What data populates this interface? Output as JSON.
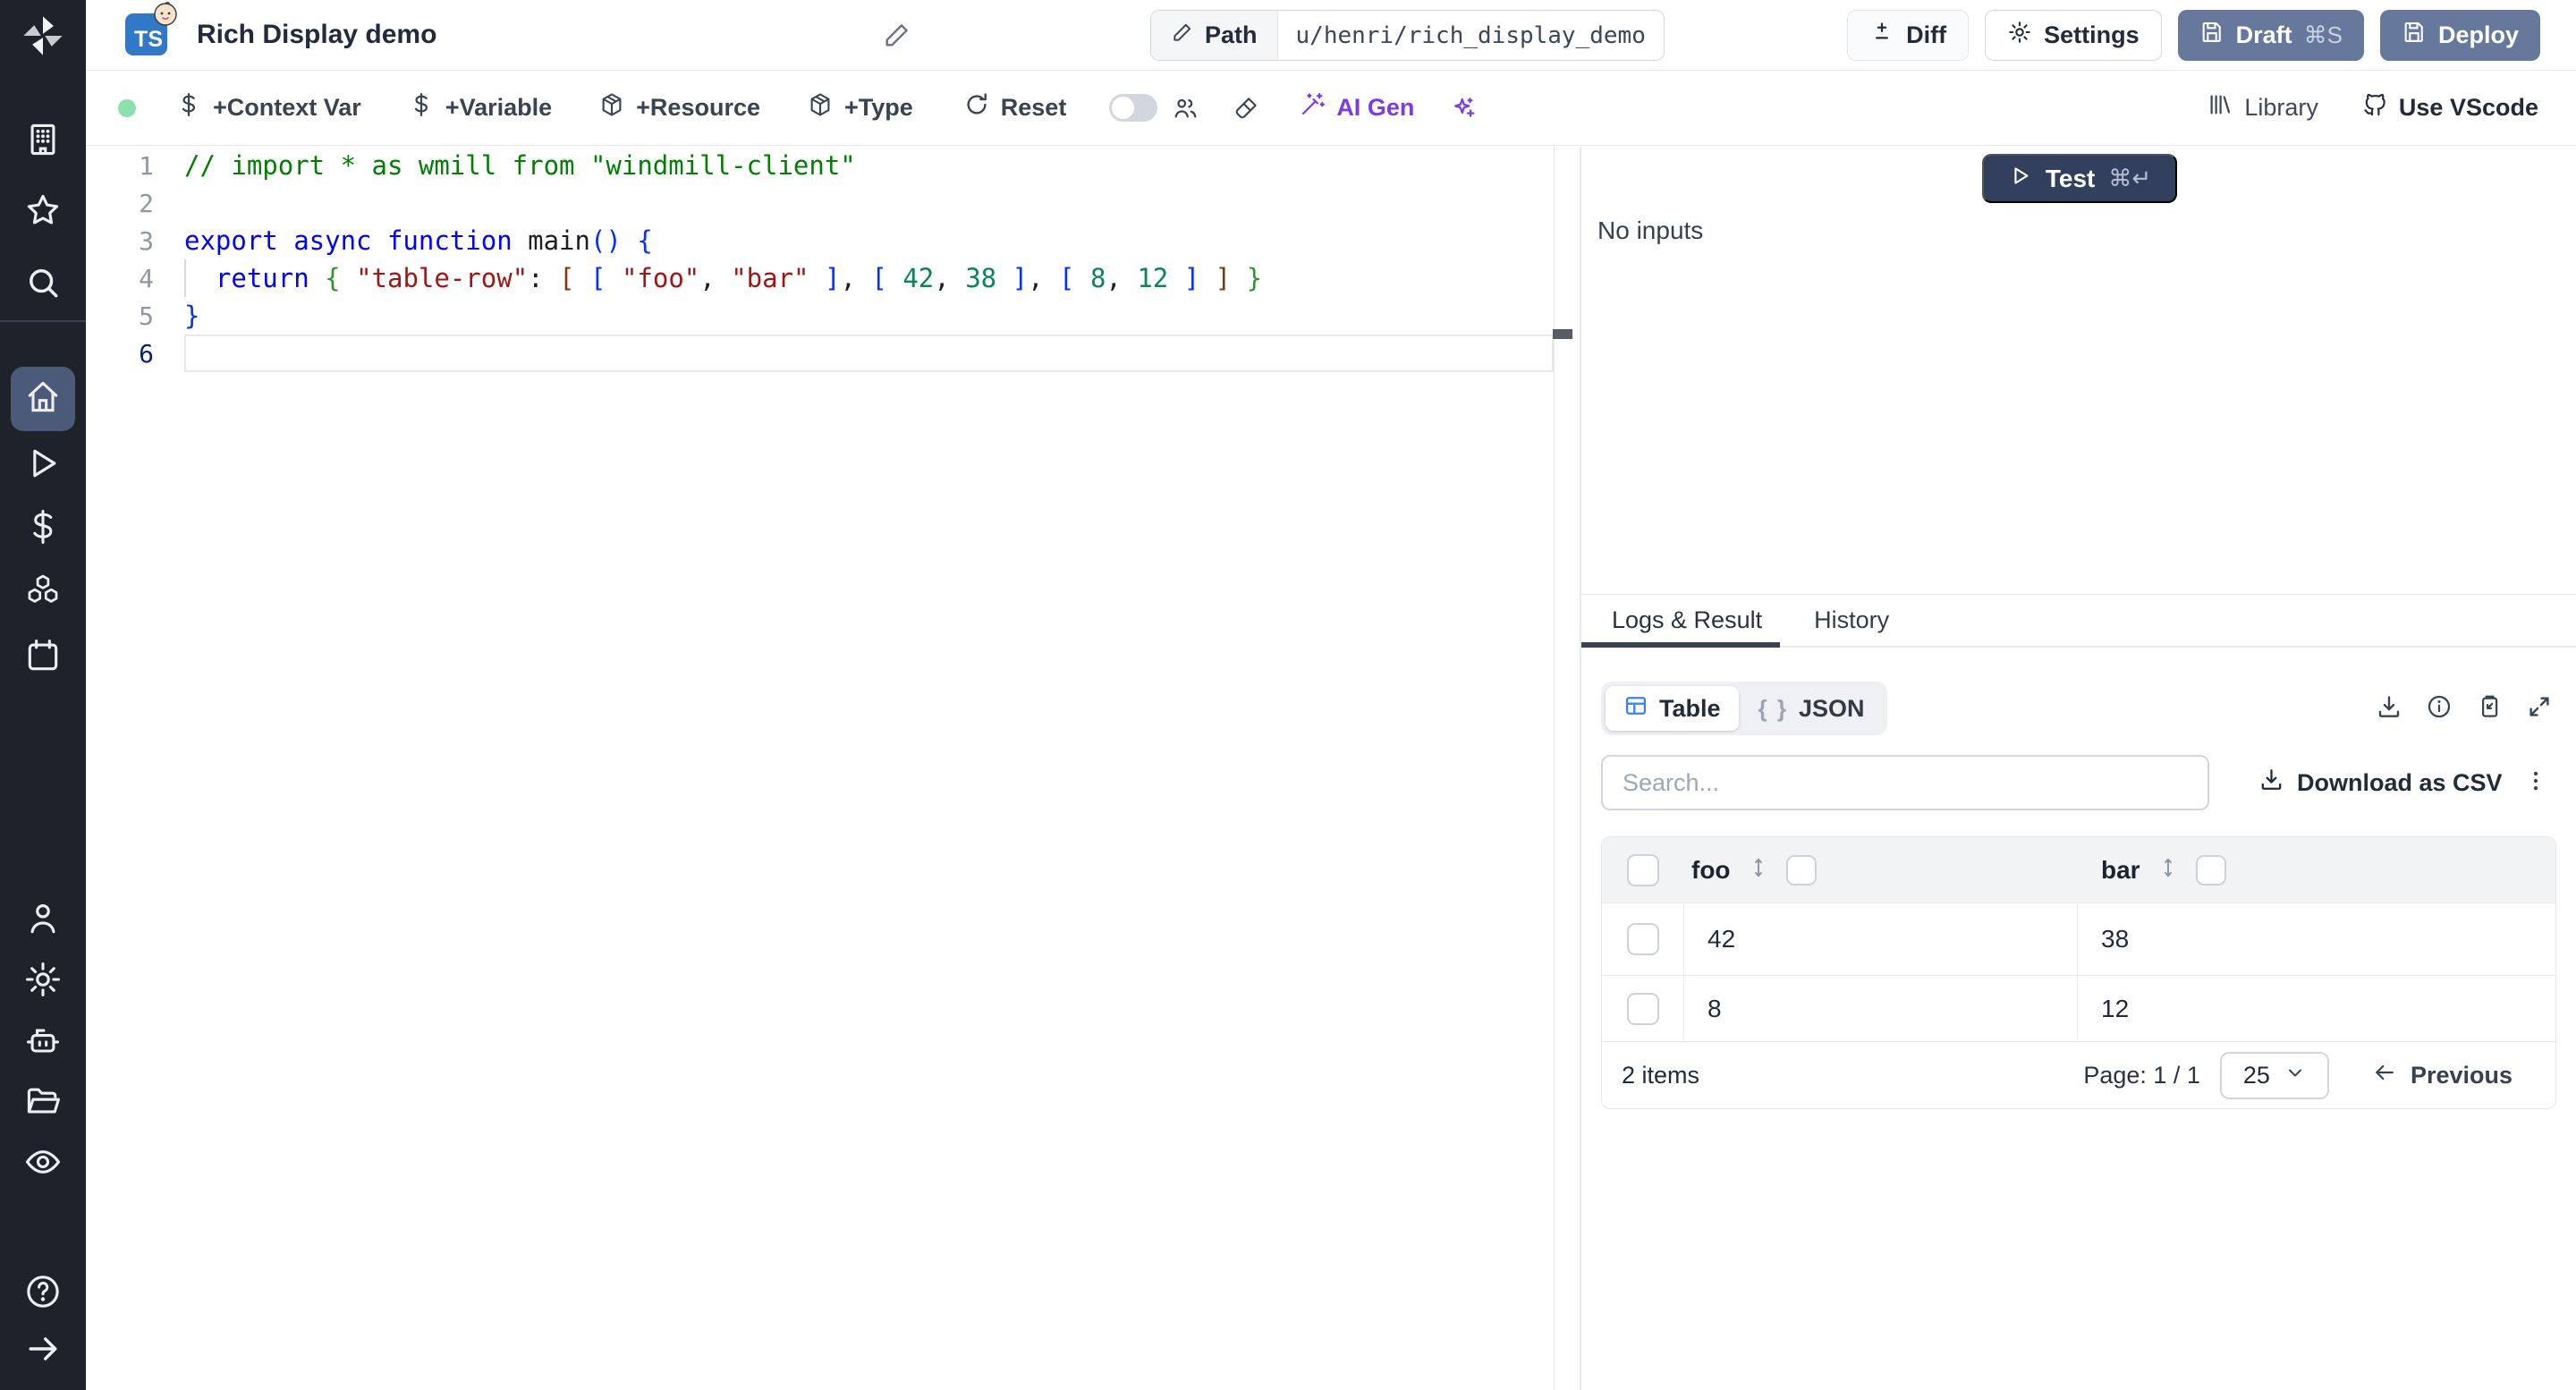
{
  "header": {
    "title": "Rich Display demo",
    "language_badge": "TS",
    "path_label": "Path",
    "path_value": "u/henri/rich_display_demo",
    "diff_label": "Diff",
    "settings_label": "Settings",
    "draft_label": "Draft",
    "draft_shortcut": "⌘S",
    "deploy_label": "Deploy"
  },
  "toolbar": {
    "add_context_var": "+Context Var",
    "add_variable": "+Variable",
    "add_resource": "+Resource",
    "add_type": "+Type",
    "reset": "Reset",
    "ai_gen": "AI Gen",
    "library": "Library",
    "use_vscode": "Use VScode"
  },
  "editor": {
    "lines": [
      {
        "n": "1",
        "tokens": [
          [
            "// import * as wmill from \"windmill-client\"",
            "comment"
          ]
        ]
      },
      {
        "n": "2",
        "tokens": []
      },
      {
        "n": "3",
        "tokens": [
          [
            "export async function ",
            "kw"
          ],
          [
            "main",
            "fn"
          ],
          [
            "(",
            "b1"
          ],
          [
            ")",
            "b1"
          ],
          [
            " ",
            "pn"
          ],
          [
            "{",
            "b1"
          ]
        ]
      },
      {
        "n": "4",
        "tokens": [
          [
            "  ",
            "pn"
          ],
          [
            "return",
            "kw"
          ],
          [
            " ",
            "pn"
          ],
          [
            "{",
            "b2"
          ],
          [
            " ",
            "pn"
          ],
          [
            "\"table-row\"",
            "str"
          ],
          [
            ":",
            "pn"
          ],
          [
            " ",
            "pn"
          ],
          [
            "[",
            "b3"
          ],
          [
            " ",
            "pn"
          ],
          [
            "[",
            "b1"
          ],
          [
            " ",
            "pn"
          ],
          [
            "\"foo\"",
            "str"
          ],
          [
            ",",
            "pn"
          ],
          [
            " ",
            "pn"
          ],
          [
            "\"bar\"",
            "str"
          ],
          [
            " ",
            "pn"
          ],
          [
            "]",
            "b1"
          ],
          [
            ",",
            "pn"
          ],
          [
            " ",
            "pn"
          ],
          [
            "[",
            "b1"
          ],
          [
            " ",
            "pn"
          ],
          [
            "42",
            "num"
          ],
          [
            ",",
            "pn"
          ],
          [
            " ",
            "pn"
          ],
          [
            "38",
            "num"
          ],
          [
            " ",
            "pn"
          ],
          [
            "]",
            "b1"
          ],
          [
            ",",
            "pn"
          ],
          [
            " ",
            "pn"
          ],
          [
            "[",
            "b1"
          ],
          [
            " ",
            "pn"
          ],
          [
            "8",
            "num"
          ],
          [
            ",",
            "pn"
          ],
          [
            " ",
            "pn"
          ],
          [
            "12",
            "num"
          ],
          [
            " ",
            "pn"
          ],
          [
            "]",
            "b1"
          ],
          [
            " ",
            "pn"
          ],
          [
            "]",
            "b3"
          ],
          [
            " ",
            "pn"
          ],
          [
            "}",
            "b2"
          ]
        ]
      },
      {
        "n": "5",
        "tokens": [
          [
            "}",
            "b1"
          ]
        ]
      },
      {
        "n": "6",
        "tokens": []
      }
    ],
    "current_line": 6
  },
  "run_panel": {
    "test_label": "Test",
    "test_shortcut": "⌘↵",
    "no_inputs": "No inputs"
  },
  "result_panel": {
    "tabs": [
      "Logs & Result",
      "History"
    ],
    "view_table_label": "Table",
    "view_json_label": "JSON",
    "json_braces_glyph": "{ }",
    "search_placeholder": "Search...",
    "download_csv_label": "Download as CSV",
    "table": {
      "columns": [
        "foo",
        "bar"
      ],
      "rows": [
        [
          "42",
          "38"
        ],
        [
          "8",
          "12"
        ]
      ],
      "items_count": "2 items",
      "page_label": "Page: 1 / 1",
      "page_size": "25",
      "previous_label": "Previous"
    }
  },
  "icons": {
    "sidebar": [
      "windmill-logo",
      "building",
      "star",
      "search",
      "home",
      "play",
      "dollar",
      "cubes",
      "calendar",
      "user",
      "gear",
      "robot",
      "folder",
      "eye",
      "help-circle",
      "arrow-right"
    ],
    "header": [
      "pencil",
      "diff-plus-minus",
      "gear",
      "save-floppy"
    ],
    "toolbar": [
      "dollar",
      "package",
      "refresh",
      "users",
      "paintbrush",
      "magic-wand",
      "sparkles",
      "library-shelf",
      "github"
    ],
    "result": [
      "download",
      "info-circle",
      "clipboard-copy",
      "expand",
      "kebab-menu",
      "sort-vertical",
      "chevron-down",
      "arrow-left",
      "table-grid",
      "json-braces"
    ]
  },
  "colors": {
    "sidebar_bg": "#1d222b",
    "sidebar_active": "#4b5a78",
    "header_button_slate": "#66799c",
    "test_button_navy": "#33405d",
    "accent_blue": "#3b82f6",
    "ai_violet": "#7c3aed",
    "green_status_dot": "#8ce0ac",
    "ts_badge_blue": "#3178c6",
    "syntax": {
      "comment": "#008000",
      "kw": "#0000ff",
      "fn": "#1f1f1f",
      "str": "#a31515",
      "num": "#098658",
      "pn": "#1f1f1f",
      "b1": "#0431fa",
      "b2": "#319331",
      "b3": "#7b3814"
    }
  }
}
